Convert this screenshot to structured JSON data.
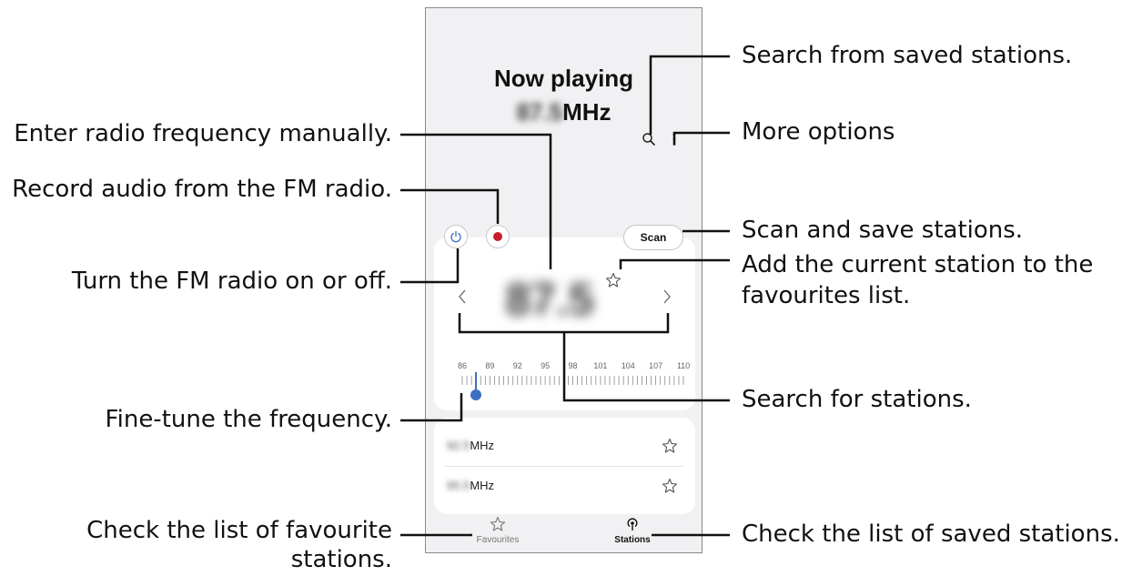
{
  "screen": {
    "now_playing_label": "Now playing",
    "now_playing_freq": "87.5",
    "now_playing_unit": "MHz",
    "frequency_display": "87.5",
    "scan_label": "Scan",
    "scale_labels": [
      "86",
      "89",
      "92",
      "95",
      "98",
      "101",
      "104",
      "107",
      "110"
    ],
    "tuner_level_mhz": 87.5,
    "stations": [
      {
        "freq": "92.5",
        "unit": "MHz"
      },
      {
        "freq": "95.5",
        "unit": "MHz"
      }
    ],
    "nav": {
      "favourites": "Favourites",
      "stations": "Stations"
    },
    "icons": {
      "search": "search-icon",
      "more": "more-options-icon",
      "power": "power-icon",
      "record": "record-icon",
      "favourite": "star-icon",
      "prev": "chevron-left-icon",
      "next": "chevron-right-icon",
      "broadcast": "broadcast-icon"
    },
    "colors": {
      "record": "#c8202a",
      "accent": "#3a6fc4"
    }
  },
  "annotations": {
    "search_saved": "Search from saved stations.",
    "more_options": "More options",
    "enter_frequency": "Enter radio frequency manually.",
    "record_audio": "Record audio from the FM radio.",
    "scan_save": "Scan and save stations.",
    "toggle_radio": "Turn the FM radio on or off.",
    "add_favourite_line1": "Add the current station to the",
    "add_favourite_line2": "favourites list.",
    "search_stations": "Search for stations.",
    "fine_tune": "Fine-tune the frequency.",
    "check_favourites_line1": "Check the list of favourite",
    "check_favourites_line2": "stations.",
    "check_saved": "Check the list of saved stations."
  }
}
